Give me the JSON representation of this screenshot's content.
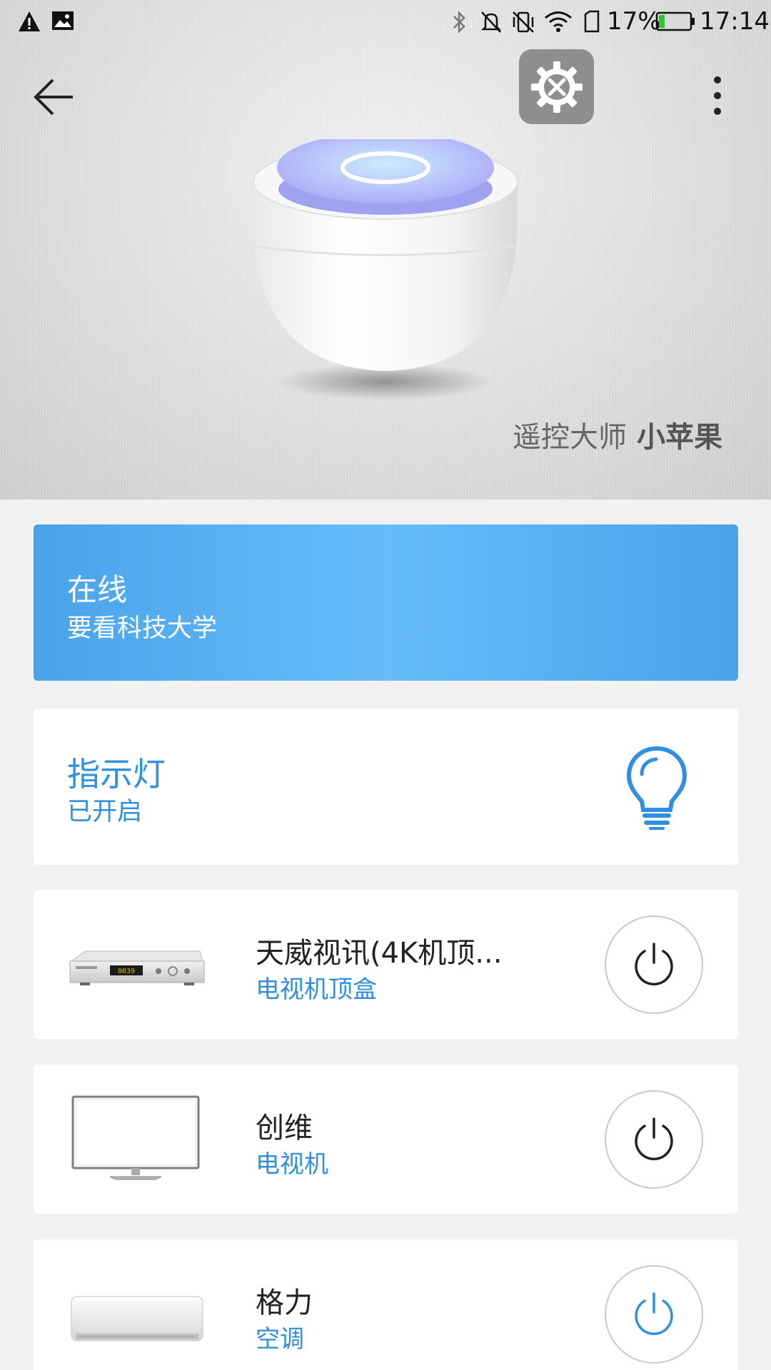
{
  "status_bar": {
    "battery_percent": "17%",
    "time": "17:14",
    "icons": [
      "warning-icon",
      "image-icon",
      "bluetooth-icon",
      "mute-icon",
      "vibrate-off-icon",
      "wifi-icon",
      "sim-icon",
      "battery-icon"
    ]
  },
  "hero": {
    "brand_prefix": "遥控大师",
    "brand_name": "小苹果"
  },
  "online_card": {
    "status": "在线",
    "location": "要看科技大学"
  },
  "indicator_card": {
    "title": "指示灯",
    "state": "已开启",
    "icon": "bulb-icon",
    "color": "#2f8fe0"
  },
  "devices": [
    {
      "name": "天威视讯(4K机顶...",
      "type": "电视机顶盒",
      "display_text": "0039",
      "power_color": "#222222"
    },
    {
      "name": "创维",
      "type": "电视机",
      "power_color": "#222222"
    },
    {
      "name": "格力",
      "type": "空调",
      "power_color": "#2f8fe0"
    }
  ],
  "colors": {
    "accent": "#2f8fe0",
    "online_card": "#5ab3f3",
    "settings_button": "#8e8e8e"
  }
}
